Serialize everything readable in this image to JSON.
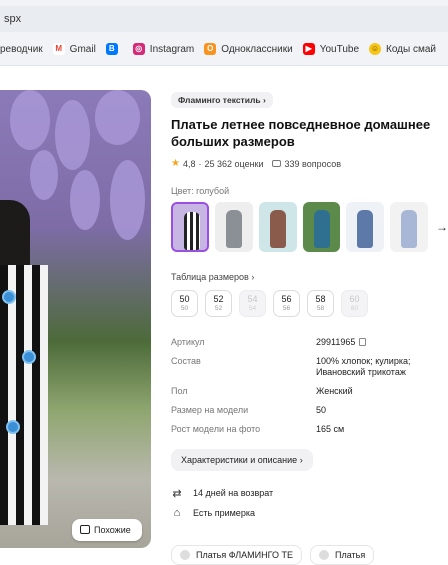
{
  "browser": {
    "address": "spx",
    "bookmarks": [
      {
        "label": "реводчик",
        "icon": "translate-icon",
        "color": "#1a73e8"
      },
      {
        "label": "Gmail",
        "icon": "gmail-icon",
        "color": "#ea4335"
      },
      {
        "label": "",
        "icon": "vk-icon",
        "color": "#0077ff"
      },
      {
        "label": "Instagram",
        "icon": "instagram-icon",
        "color": "#d62976"
      },
      {
        "label": "Одноклассники",
        "icon": "odnoklassniki-icon",
        "color": "#f7931e"
      },
      {
        "label": "YouTube",
        "icon": "youtube-icon",
        "color": "#ff0000"
      },
      {
        "label": "Коды смай",
        "icon": "smiley-icon",
        "color": "#f5c518"
      }
    ]
  },
  "product": {
    "brand": "Фламинго текстиль",
    "title": "Платье летнее повседневное домашнее больших размеров",
    "rating": "4,8",
    "reviews": "25 362 оценки",
    "questions": "339 вопросов",
    "color_label": "Цвет: голубой",
    "sizes_label": "Таблица размеров",
    "sizes": [
      {
        "size": "50",
        "sub": "50",
        "available": true
      },
      {
        "size": "52",
        "sub": "52",
        "available": true
      },
      {
        "size": "54",
        "sub": "54",
        "available": false
      },
      {
        "size": "56",
        "sub": "56",
        "available": true
      },
      {
        "size": "58",
        "sub": "58",
        "available": true
      },
      {
        "size": "60",
        "sub": "60",
        "available": false
      }
    ],
    "specs": [
      {
        "key": "Артикул",
        "value": "29911965"
      },
      {
        "key": "Состав",
        "value": "100% хлопок; кулирка; Ивановский трикотаж"
      },
      {
        "key": "Пол",
        "value": "Женский"
      },
      {
        "key": "Размер на модели",
        "value": "50"
      },
      {
        "key": "Рост модели на фото",
        "value": "165 см"
      }
    ],
    "characteristics_button": "Характеристики и описание",
    "services": [
      {
        "icon": "return-icon",
        "label": "14 дней на возврат"
      },
      {
        "icon": "hanger-icon",
        "label": "Есть примерка"
      }
    ],
    "similar_button": "Похожие",
    "bottom_chips": [
      "Платья ФЛАМИНГО ТЕ",
      "Платья"
    ]
  }
}
